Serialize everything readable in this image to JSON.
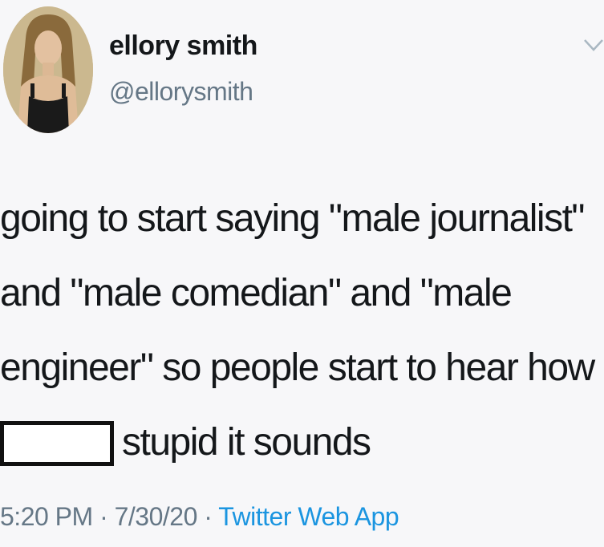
{
  "tweet": {
    "author": {
      "name": "ellory smith",
      "handle": "@ellorysmith"
    },
    "text_lines": [
      "going to start saying \"male journalist\"",
      "and \"male comedian\" and \"male",
      "engineer\" so people start to hear how",
      "stupid it sounds"
    ],
    "meta": {
      "time": "5:20 PM",
      "sep1": " · ",
      "date": "7/30/20",
      "sep2": " · ",
      "source": "Twitter Web App"
    }
  },
  "colors": {
    "text": "#14171a",
    "secondary": "#657786",
    "link": "#1b95e0"
  },
  "icons": [
    "chevron-down-icon"
  ]
}
